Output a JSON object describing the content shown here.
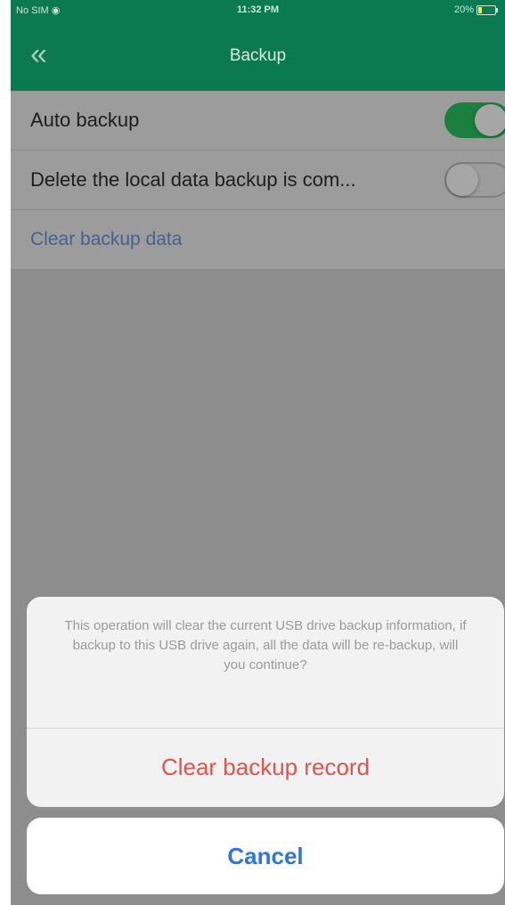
{
  "status_bar": {
    "carrier": "No SIM",
    "wifi_icon": "wifi-icon",
    "time": "11:32 PM",
    "battery": "20%"
  },
  "nav": {
    "back_icon": "double-chevron-left-icon",
    "title": "Backup"
  },
  "settings": {
    "auto_backup": {
      "label": "Auto backup",
      "enabled": true
    },
    "delete_local": {
      "label": "Delete the local data backup is com...",
      "enabled": false
    },
    "clear_backup": {
      "label": "Clear backup data"
    }
  },
  "action_sheet": {
    "message": "This operation will clear the current USB drive backup information, if backup to this USB drive again, all the data will be re-backup, will you continue?",
    "confirm_label": "Clear backup record",
    "cancel_label": "Cancel"
  },
  "colors": {
    "header": "#0b7a52",
    "toggle_on": "#1a7f3f",
    "destructive": "#e0544d",
    "cancel": "#2f77d6",
    "link": "#47618c"
  }
}
